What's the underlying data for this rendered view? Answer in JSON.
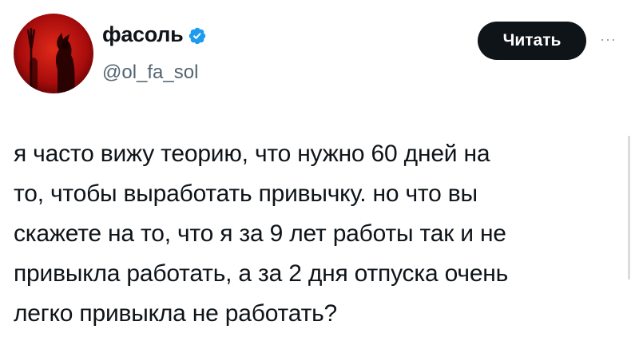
{
  "author": {
    "display_name": "фасоль",
    "handle": "@ol_fa_sol",
    "verified": true
  },
  "follow_button": {
    "label": "Читать"
  },
  "more_menu": {
    "label": "···"
  },
  "tweet": {
    "text": "я часто вижу теорию, что нужно 60 дней на\nто, чтобы выработать привычку. но что вы\nскажете на то, что я за 9 лет работы так и не\nпривыкла работать, а за 2 дня отпуска очень\nлегко привыкла не работать?"
  },
  "colors": {
    "verified": "#1d9bf0",
    "button_bg": "#0f1419",
    "handle": "#536471",
    "avatar_bg": "#b01010"
  },
  "icons": {
    "verified": "verified-badge-icon",
    "more": "more-dots-icon"
  }
}
